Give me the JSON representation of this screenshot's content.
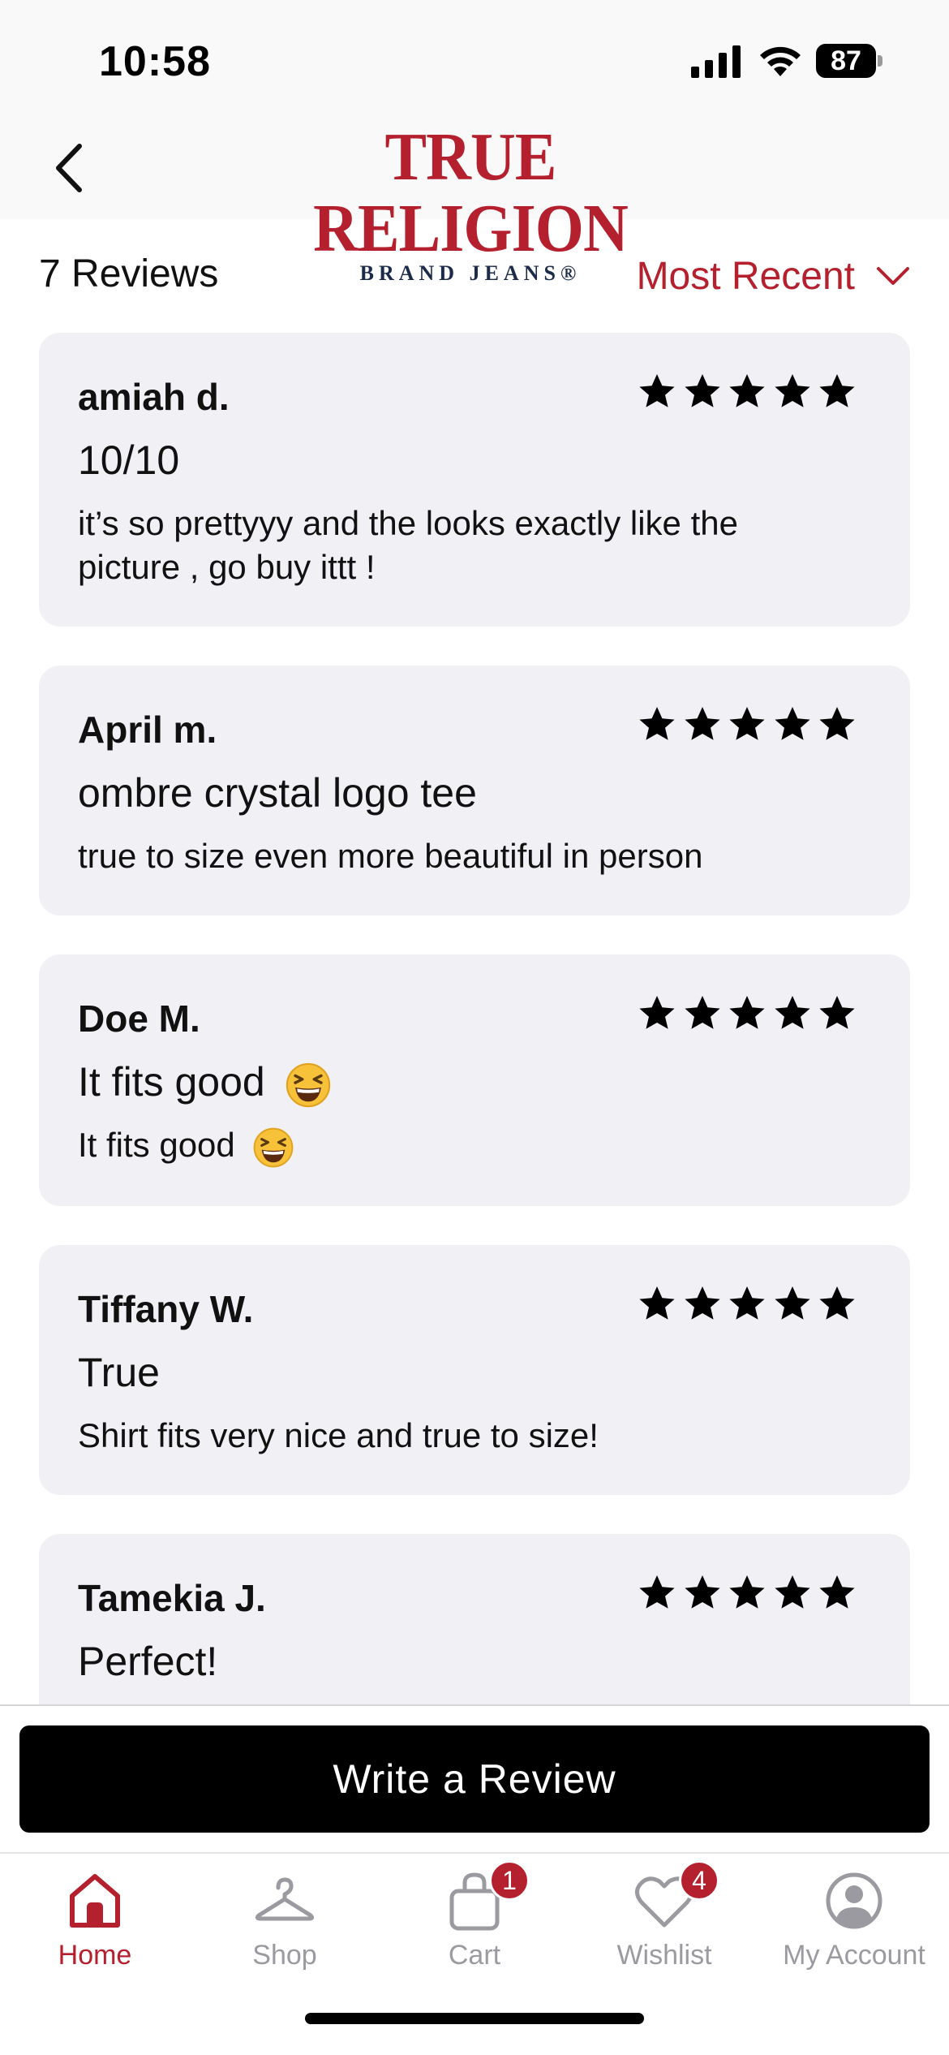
{
  "status": {
    "time": "10:58",
    "battery": "87"
  },
  "header": {
    "brand_main": "TRUE RELIGION",
    "brand_sub": "BRAND JEANS®"
  },
  "reviews_bar": {
    "count_label": "7 Reviews",
    "sort_label": "Most Recent"
  },
  "reviews": [
    {
      "name": "amiah d.",
      "title": "10/10",
      "body": "it’s so prettyyy and the looks exactly like the picture , go buy ittt !",
      "rating": 5
    },
    {
      "name": "April m.",
      "title": "ombre crystal logo tee",
      "body": "true to size even more beautiful in person",
      "rating": 5
    },
    {
      "name": "Doe M.",
      "title": "It fits good",
      "body": "It fits good",
      "rating": 5
    },
    {
      "name": "Tiffany W.",
      "title": "True",
      "body": "Shirt fits very nice and true to size!",
      "rating": 5
    },
    {
      "name": "Tamekia J.",
      "title": "Perfect!",
      "body": "",
      "rating": 5
    }
  ],
  "actions": {
    "write_review_label": "Write a Review"
  },
  "tab_bar": {
    "home": "Home",
    "shop": "Shop",
    "cart": "Cart",
    "cart_badge": "1",
    "wishlist": "Wishlist",
    "wishlist_badge": "4",
    "account": "My Account"
  },
  "icons": {
    "back": "chevron-left-icon",
    "sort": "chevron-down-icon",
    "star": "star-icon",
    "emoji": "grinning-squinting-face-icon",
    "home": "home-icon",
    "shop": "hanger-icon",
    "cart": "bag-icon",
    "wishlist": "heart-icon",
    "account": "user-circle-icon"
  },
  "colors": {
    "brand_red": "#b5202e",
    "brand_navy": "#1c2b4a",
    "card_bg": "#f1f1f5",
    "inactive_tab": "#9a9aa0"
  }
}
